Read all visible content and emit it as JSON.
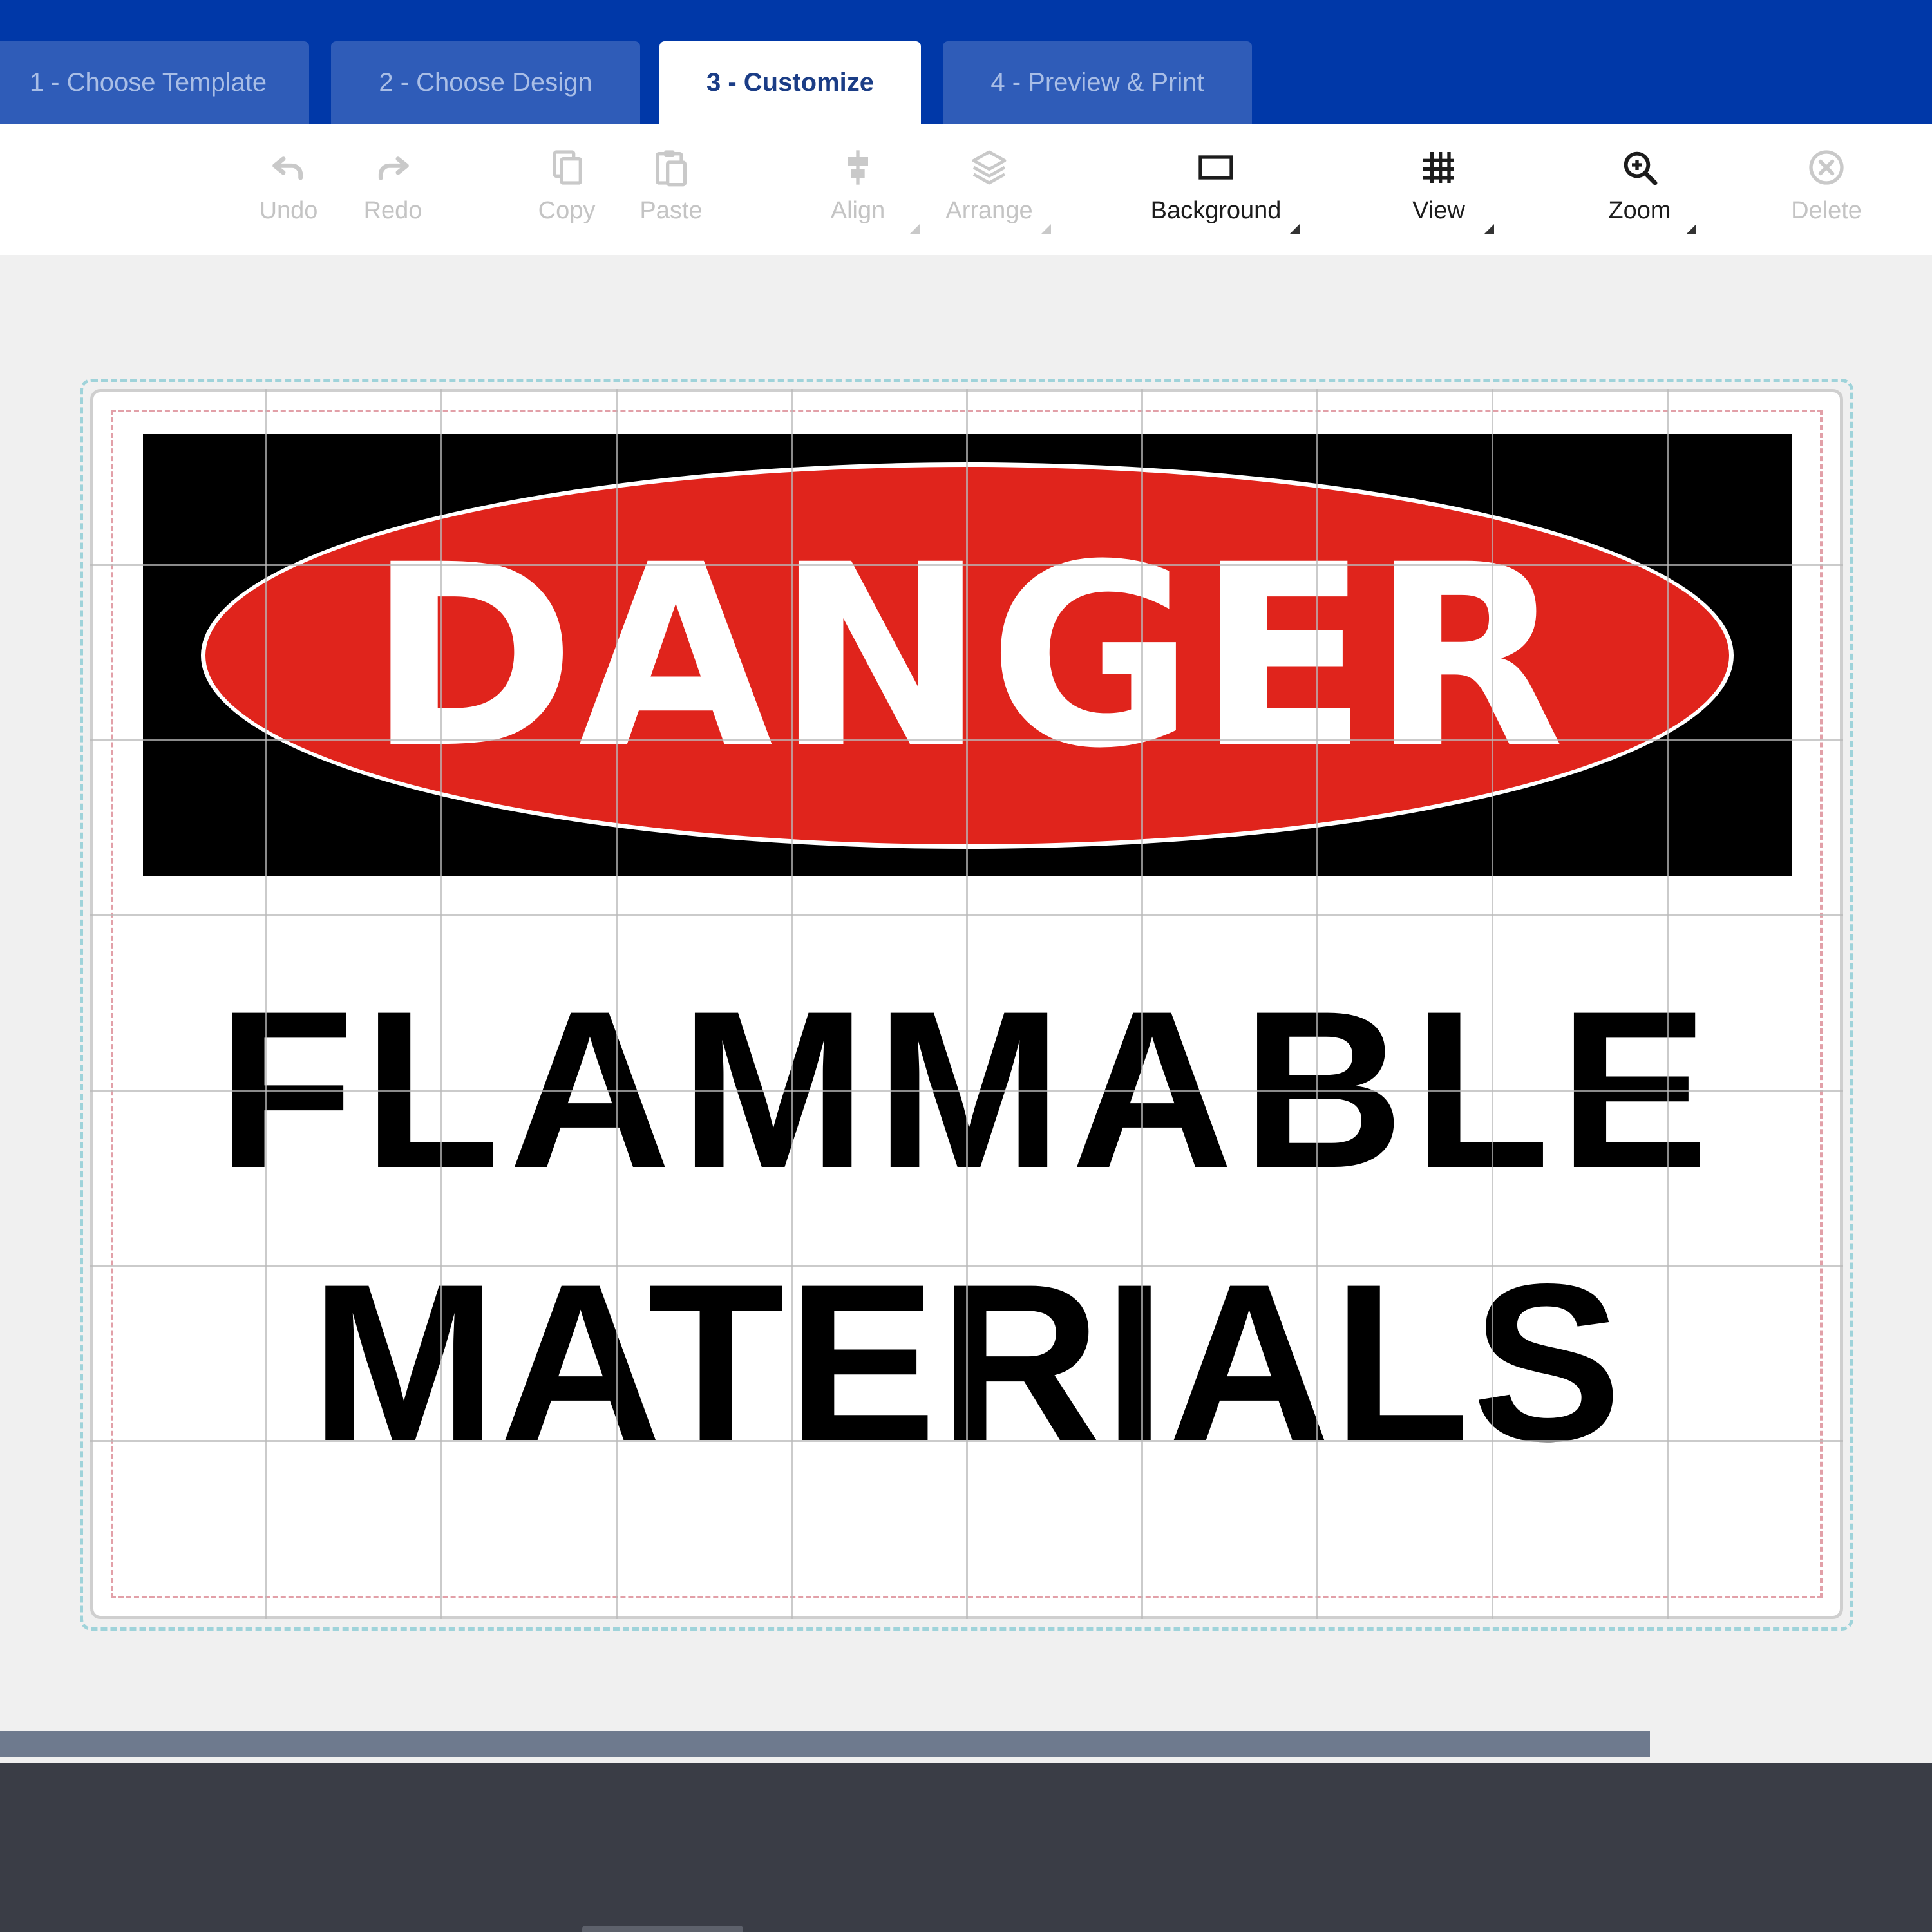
{
  "tabs": [
    {
      "label": "1 - Choose Template",
      "active": false
    },
    {
      "label": "2 - Choose Design",
      "active": false
    },
    {
      "label": "3 - Customize",
      "active": true
    },
    {
      "label": "4 - Preview & Print",
      "active": false
    }
  ],
  "toolbar": {
    "undo": {
      "label": "Undo",
      "icon": "undo-icon",
      "enabled": false
    },
    "redo": {
      "label": "Redo",
      "icon": "redo-icon",
      "enabled": false
    },
    "copy": {
      "label": "Copy",
      "icon": "copy-icon",
      "enabled": false
    },
    "paste": {
      "label": "Paste",
      "icon": "paste-icon",
      "enabled": false
    },
    "align": {
      "label": "Align",
      "icon": "align-icon",
      "enabled": false,
      "has_dropdown": true
    },
    "arrange": {
      "label": "Arrange",
      "icon": "layers-icon",
      "enabled": false,
      "has_dropdown": true
    },
    "background": {
      "label": "Background",
      "icon": "rectangle-icon",
      "enabled": true,
      "has_dropdown": true
    },
    "view": {
      "label": "View",
      "icon": "grid-icon",
      "enabled": true,
      "has_dropdown": true
    },
    "zoom": {
      "label": "Zoom",
      "icon": "zoom-in-icon",
      "enabled": true,
      "has_dropdown": true
    },
    "delete": {
      "label": "Delete",
      "icon": "delete-icon",
      "enabled": false
    }
  },
  "sign": {
    "header_text": "DANGER",
    "line1": "FLAMMABLE",
    "line2": "MATERIALS",
    "grid_visible": true
  },
  "colors": {
    "tabbar": "#0038a8",
    "tab_inactive": "#2f5cb8",
    "danger_red": "#e0241c",
    "header_black": "#000000",
    "footer_panel": "#3a3d46"
  }
}
